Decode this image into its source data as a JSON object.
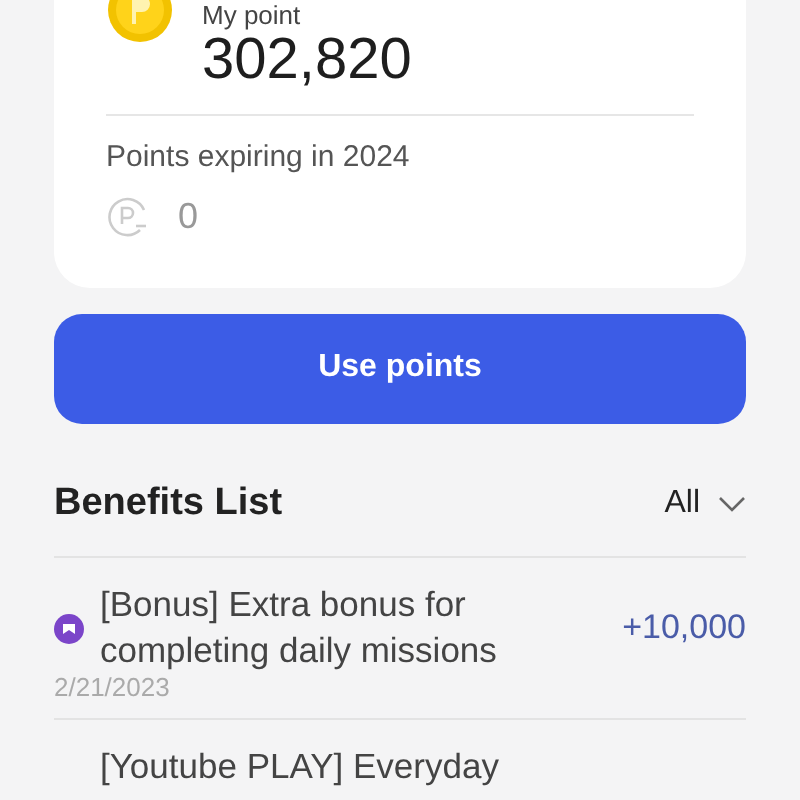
{
  "points_card": {
    "label": "My point",
    "balance": "302,820",
    "expiring_label": "Points expiring in 2024",
    "expiring_amount": "0"
  },
  "use_button": "Use points",
  "benefits": {
    "title": "Benefits List",
    "filter": "All",
    "items": [
      {
        "title": "[Bonus] Extra bonus for completing daily missions",
        "amount": "+10,000",
        "date": "2/21/2023",
        "kind": "mission"
      },
      {
        "title": "[Youtube PLAY] Everyday",
        "kind": "plain"
      }
    ]
  }
}
